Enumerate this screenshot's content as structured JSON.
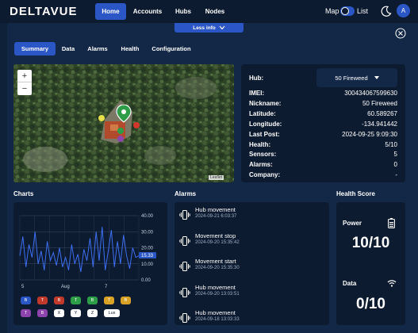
{
  "app": {
    "logo": "DELTAVUE",
    "avatar_initial": "A"
  },
  "nav": {
    "items": [
      "Home",
      "Accounts",
      "Hubs",
      "Nodes"
    ],
    "active": "Home",
    "map_label": "Map",
    "list_label": "List"
  },
  "panel": {
    "less_info": "Less info"
  },
  "tabs": [
    "Summary",
    "Data",
    "Alarms",
    "Health",
    "Configuration"
  ],
  "map": {
    "zoom_in": "+",
    "zoom_out": "−",
    "attribution": "Leaflet"
  },
  "info": {
    "hub_label": "Hub:",
    "hub_selected": "50 Fireweed",
    "rows": [
      {
        "label": "IMEI:",
        "value": "300434067599630"
      },
      {
        "label": "Nickname:",
        "value": "50 Fireweed"
      },
      {
        "label": "Latitude:",
        "value": "60.589267"
      },
      {
        "label": "Longitude:",
        "value": "-134.941442"
      },
      {
        "label": "Last Post:",
        "value": "2024-09-25 9:09:30"
      },
      {
        "label": "Health:",
        "value": "5/10"
      },
      {
        "label": "Sensors:",
        "value": "5"
      },
      {
        "label": "Alarms:",
        "value": "0"
      },
      {
        "label": "Company:",
        "value": "-"
      }
    ]
  },
  "sections": {
    "charts": "Charts",
    "alarms": "Alarms",
    "health": "Health Score"
  },
  "chart_data": {
    "type": "line",
    "x_ticks": [
      "5",
      "Aug",
      "7"
    ],
    "y_ticks": [
      "40.00",
      "30.00",
      "20.00",
      "10.00",
      "0.00"
    ],
    "ylim": [
      0,
      40
    ],
    "current_value": "15.33",
    "series": [
      {
        "values": [
          15,
          27,
          8,
          22,
          14,
          30,
          10,
          18,
          6,
          24,
          12,
          17,
          9,
          20,
          8,
          14,
          6,
          22,
          10,
          16,
          5,
          19,
          12,
          26,
          8,
          30,
          12,
          33,
          6,
          18,
          31,
          8,
          24,
          10,
          28,
          15,
          7,
          20,
          14,
          15
        ]
      }
    ],
    "grid": true
  },
  "chart_chips": [
    {
      "label": "B",
      "color": "#2b57c6"
    },
    {
      "label": "T",
      "color": "#c0392b"
    },
    {
      "label": "B",
      "color": "#c0392b"
    },
    {
      "label": "T",
      "color": "#2e9d48"
    },
    {
      "label": "B",
      "color": "#2e9d48"
    },
    {
      "label": "T",
      "color": "#d9a227"
    },
    {
      "label": "B",
      "color": "#d9a227"
    },
    {
      "label": "T",
      "color": "#8e44ad"
    },
    {
      "label": "B",
      "color": "#8e44ad"
    },
    {
      "label": "X",
      "color": "#ffffff"
    },
    {
      "label": "Y",
      "color": "#ffffff"
    },
    {
      "label": "Z",
      "color": "#ffffff"
    },
    {
      "label": "Lux",
      "color": "#ffffff"
    }
  ],
  "alarms": [
    {
      "title": "Hub movement",
      "time": "2024-09-21 6:03:37"
    },
    {
      "title": "Movement stop",
      "time": "2024-09-20 15:35:42"
    },
    {
      "title": "Movement start",
      "time": "2024-09-20 15:35:30"
    },
    {
      "title": "Hub movement",
      "time": "2024-09-20 13:03:51"
    },
    {
      "title": "Hub movement",
      "time": "2024-09-18 13:03:33"
    }
  ],
  "health": {
    "power_label": "Power",
    "power_value": "10/10",
    "data_label": "Data",
    "data_value": "0/10"
  }
}
